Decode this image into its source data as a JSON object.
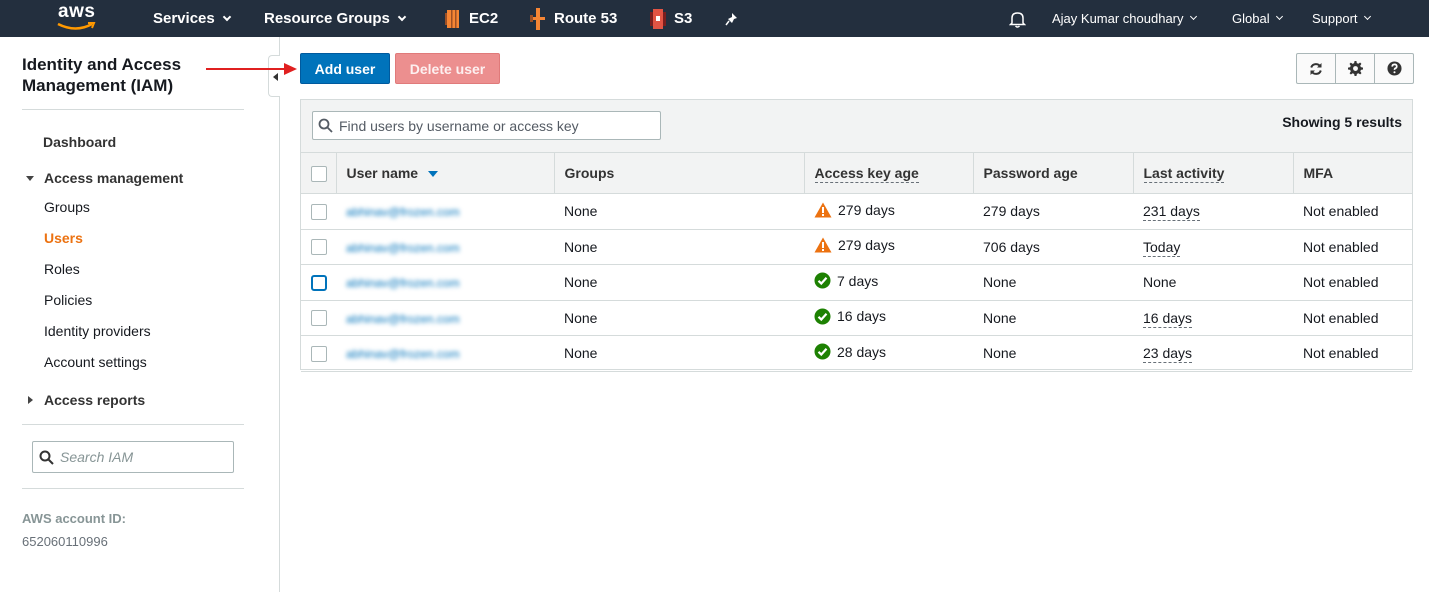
{
  "nav": {
    "logo": "aws",
    "services": "Services",
    "resource_groups": "Resource Groups",
    "pinned": [
      {
        "label": "EC2",
        "icon": "ec2-icon",
        "color": "#f58534"
      },
      {
        "label": "Route 53",
        "icon": "route53-icon",
        "color": "#f58534"
      },
      {
        "label": "S3",
        "icon": "s3-icon",
        "color": "#e25444"
      }
    ],
    "pin_icon": "pin-icon",
    "bell_icon": "bell-icon",
    "user": "Ajay Kumar choudhary",
    "region": "Global",
    "support": "Support"
  },
  "sidebar": {
    "title": "Identity and Access Management (IAM)",
    "dashboard": "Dashboard",
    "access_management": "Access management",
    "items": [
      "Groups",
      "Users",
      "Roles",
      "Policies",
      "Identity providers",
      "Account settings"
    ],
    "active_item": "Users",
    "access_reports": "Access reports",
    "search_placeholder": "Search IAM",
    "account_id_label": "AWS account ID:",
    "account_id": "652060110996"
  },
  "toolbar": {
    "add_user": "Add user",
    "delete_user": "Delete user",
    "refresh_icon": "refresh-icon",
    "settings_icon": "gear-icon",
    "help_icon": "help-icon"
  },
  "table": {
    "search_placeholder": "Find users by username or access key",
    "showing": "Showing 5 results",
    "columns": [
      "User name",
      "Groups",
      "Access key age",
      "Password age",
      "Last activity",
      "MFA"
    ],
    "rows": [
      {
        "user": "abhinav@frozen.com",
        "groups": "None",
        "key_age": "279 days",
        "key_status": "warning",
        "password_age": "279 days",
        "last_activity": "231 days",
        "mfa": "Not enabled"
      },
      {
        "user": "abhinav@frozen.com",
        "groups": "None",
        "key_age": "279 days",
        "key_status": "warning",
        "password_age": "706 days",
        "last_activity": "Today",
        "mfa": "Not enabled"
      },
      {
        "user": "abhinav@frozen.com",
        "groups": "None",
        "key_age": "7 days",
        "key_status": "ok",
        "password_age": "None",
        "last_activity": "None",
        "mfa": "Not enabled"
      },
      {
        "user": "abhinav@frozen.com",
        "groups": "None",
        "key_age": "16 days",
        "key_status": "ok",
        "password_age": "None",
        "last_activity": "16 days",
        "mfa": "Not enabled"
      },
      {
        "user": "abhinav@frozen.com",
        "groups": "None",
        "key_age": "28 days",
        "key_status": "ok",
        "password_age": "None",
        "last_activity": "23 days",
        "mfa": "Not enabled"
      }
    ]
  },
  "colors": {
    "nav_bg": "#232f3e",
    "primary": "#0073bb",
    "active": "#ec7211",
    "warning": "#ec7211",
    "ok": "#1d8102",
    "annotation_arrow": "#e02020"
  }
}
